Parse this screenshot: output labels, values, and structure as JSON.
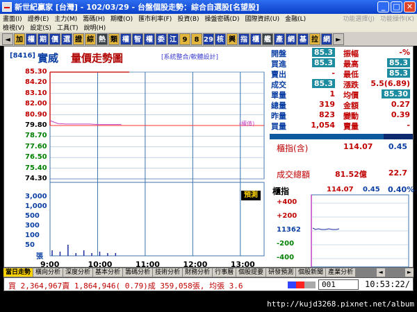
{
  "window": {
    "title": "新世紀贏家 [台灣] - 102/03/29 - 台盤個股走勢：綜合自選股[名望股]"
  },
  "menu_row1": [
    "畫面(I)",
    "證券(E)",
    "主力(M)",
    "籌碼(H)",
    "期權(O)",
    "匯市利率(F)",
    "投資(B)",
    "操盤密碼(D)",
    "國際資訊(U)",
    "金融(L)",
    "功能選擇(J)",
    "功能操作(K)"
  ],
  "menu_row2": [
    "檢視(V)",
    "設定(S)",
    "工具(T)",
    "說明(H)"
  ],
  "toolbar": [
    "◄",
    "加",
    "權",
    "期",
    "價",
    "選",
    "證",
    "綜",
    "熱",
    "類",
    "權",
    "智",
    "權",
    "委",
    "江",
    "9",
    "8",
    "29",
    "核",
    "興",
    "指",
    "櫃",
    "艦",
    "產",
    "網",
    "基",
    "拉",
    "網",
    "►"
  ],
  "stock": {
    "code": "[8416]",
    "name": "實威",
    "chart_title": "量價走勢圖",
    "note": "[系統整合/軟體設計]",
    "limit_label": "(權值)",
    "predict_label": "預測"
  },
  "price_axis": [
    "85.30",
    "84.20",
    "83.10",
    "82.00",
    "80.90",
    "79.80",
    "78.70",
    "77.60",
    "76.50",
    "75.40",
    "74.30"
  ],
  "volume_axis": [
    "3,000",
    "1,000",
    "500",
    "300",
    "100",
    "50",
    "張"
  ],
  "time_axis": [
    "9:00",
    "10:00",
    "11:00",
    "12:00",
    "13:00"
  ],
  "quote": [
    {
      "l1": "開盤",
      "v1": "85.3",
      "v1hl": true,
      "l2": "振幅",
      "v2": "-%",
      "v2hl": false
    },
    {
      "l1": "買進",
      "v1": "85.3",
      "v1hl": true,
      "l2": "最高",
      "v2": "85.3",
      "v2hl": true
    },
    {
      "l1": "賣出",
      "v1": "-",
      "v1hl": false,
      "l2": "最低",
      "v2": "85.3",
      "v2hl": true
    },
    {
      "l1": "成交",
      "v1": "85.3",
      "v1hl": true,
      "l2": "漲跌",
      "v2": "5.5(6.89)",
      "v2hl": false
    },
    {
      "l1": "單量",
      "v1": "1",
      "v1hl": false,
      "l2": "均價",
      "v2": "85.30",
      "v2hl": true
    },
    {
      "l1": "總量",
      "v1": "319",
      "v1hl": false,
      "l2": "金額",
      "v2": "0.27",
      "v2hl": false
    },
    {
      "l1": "昨量",
      "v1": "823",
      "v1hl": false,
      "l2": "變動",
      "v2": "0.39",
      "v2hl": false
    },
    {
      "l1": "買量",
      "v1": "1,054",
      "v1hl": false,
      "l2": "賣量",
      "v2": "-",
      "v2hl": false
    }
  ],
  "index_panel": {
    "label1": "櫃指(含)",
    "val1": "114.07",
    "chg1": "0.45",
    "label2": "成交總額",
    "val2": "81.52億",
    "chg2": "22.7"
  },
  "mini": {
    "label": "櫃指",
    "price": "114.07",
    "change": "0.45",
    "pct": "0.40%",
    "axis": [
      "+400",
      "+200",
      "11362",
      "-200",
      "-400"
    ]
  },
  "tabs": [
    "當日走勢",
    "橫向分析",
    "深度分析",
    "基本分析",
    "籌碼分析",
    "技術分析",
    "財務分析",
    "行事曆",
    "個股提要",
    "研發預測",
    "個股新聞",
    "產業分析"
  ],
  "status": {
    "ticker": "買 2,364,967賣 1,864,946( 0.79)成 359,058張, 均張 3.6",
    "code": "001",
    "clock": "10:53:22/"
  },
  "footer_url": "http://kujd3268.pixnet.net/album",
  "chart_data": {
    "type": "line",
    "title": "量價走勢圖",
    "x": [
      "9:00",
      "9:10",
      "9:20",
      "9:30",
      "9:40",
      "9:50",
      "10:00",
      "10:10",
      "10:20",
      "10:30",
      "10:40"
    ],
    "series": [
      {
        "values": [
          85.3,
          85.3,
          85.3,
          85.3,
          85.3,
          85.3,
          85.3,
          85.3,
          85.3,
          85.3,
          85.3
        ]
      }
    ],
    "avg_line": [
      80.3,
      80.0,
      79.95,
      79.95,
      79.95,
      79.95,
      79.9,
      79.9,
      79.9,
      79.9
    ],
    "ylim": [
      74.3,
      85.3
    ],
    "reference_price": 79.8,
    "volume_ticks": [
      0.2,
      0.15,
      0.4,
      0.1,
      0.2,
      0.1,
      0.15,
      0.1,
      0.1
    ],
    "colors": {
      "price_line": "#d42020",
      "avg_line": "#c040c0",
      "grid": "#3c72ac",
      "ref": "#ff3333"
    }
  }
}
